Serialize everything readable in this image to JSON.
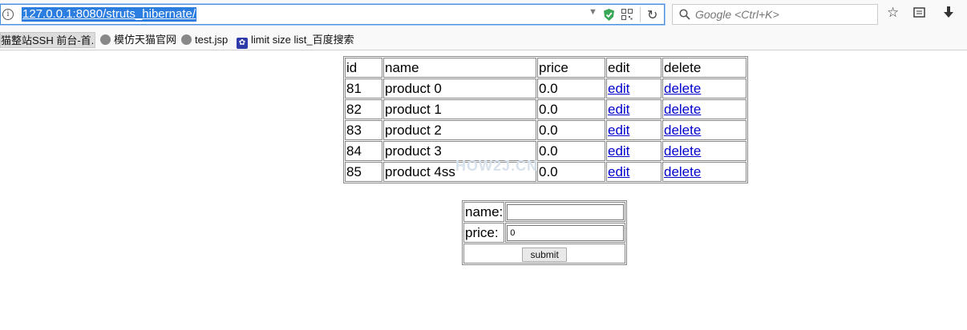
{
  "browser": {
    "url": "127.0.0.1:8080/struts_hibernate/",
    "search_placeholder": "Google <Ctrl+K>",
    "bookmarks": [
      "猫整站SSH 前台-首...",
      "模仿天猫官网",
      "test.jsp",
      "limit size list_百度搜索"
    ]
  },
  "table": {
    "headers": [
      "id",
      "name",
      "price",
      "edit",
      "delete"
    ],
    "rows": [
      {
        "id": "81",
        "name": "product 0",
        "price": "0.0",
        "edit": "edit",
        "delete": "delete"
      },
      {
        "id": "82",
        "name": "product 1",
        "price": "0.0",
        "edit": "edit",
        "delete": "delete"
      },
      {
        "id": "83",
        "name": "product 2",
        "price": "0.0",
        "edit": "edit",
        "delete": "delete"
      },
      {
        "id": "84",
        "name": "product 3",
        "price": "0.0",
        "edit": "edit",
        "delete": "delete"
      },
      {
        "id": "85",
        "name": "product 4ss",
        "price": "0.0",
        "edit": "edit",
        "delete": "delete"
      }
    ]
  },
  "watermark": "HOW2J.CN",
  "form": {
    "name_label": "name:",
    "name_value": "",
    "price_label": "price:",
    "price_value": "0",
    "submit_label": "submit"
  }
}
